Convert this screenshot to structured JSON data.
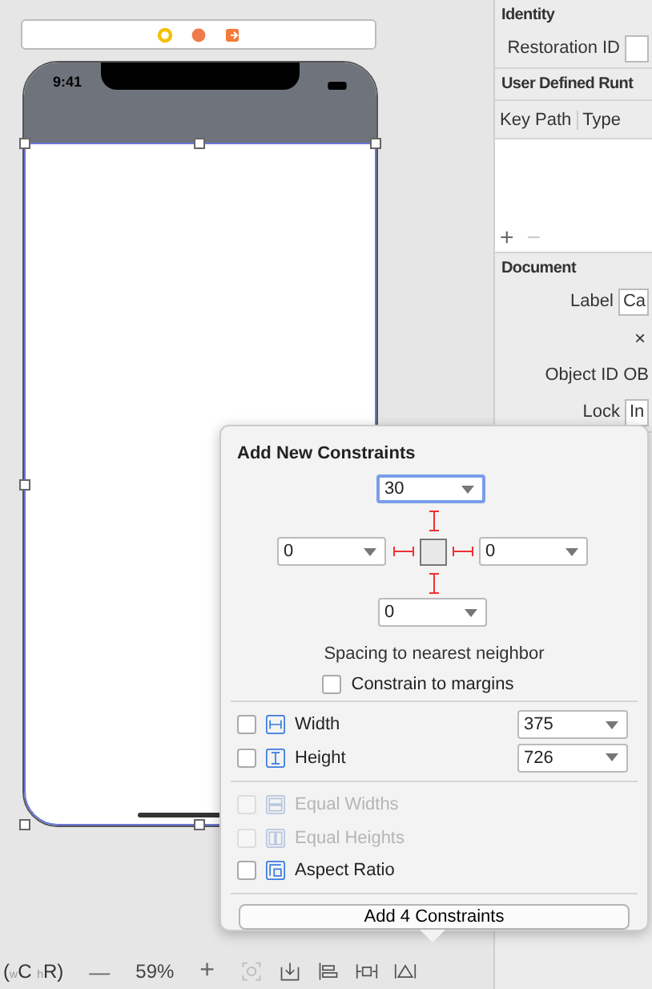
{
  "scene": {
    "status_time": "9:41"
  },
  "inspector": {
    "identity": {
      "title": "Identity",
      "restoration_label": "Restoration ID"
    },
    "runtime": {
      "title": "User Defined Runt",
      "columns": [
        "Key Path",
        "Type"
      ],
      "add": "+",
      "remove": "−"
    },
    "document": {
      "title": "Document",
      "label_label": "Label",
      "label_value": "Ca",
      "clear": "×",
      "object_id_label": "Object ID",
      "object_id_value": "OB",
      "lock_label": "Lock",
      "lock_value": "In"
    }
  },
  "bottom_bar": {
    "size_class": "($_{w}$C $_{h}$R)",
    "zoom_out": "—",
    "zoom": "59%",
    "zoom_in": "+"
  },
  "popover": {
    "title": "Add New Constraints",
    "spacing": {
      "top": {
        "value": "30",
        "on": true,
        "focused": true
      },
      "left": {
        "value": "0",
        "on": true,
        "focused": false
      },
      "right": {
        "value": "0",
        "on": true,
        "focused": false
      },
      "bottom": {
        "value": "0",
        "on": true,
        "focused": false
      }
    },
    "spacing_caption": "Spacing to nearest neighbor",
    "margins": {
      "label": "Constrain to margins",
      "checked": false
    },
    "rows": [
      {
        "kind": "width",
        "label": "Width",
        "checked": false,
        "disabled": false,
        "value": "375"
      },
      {
        "kind": "height",
        "label": "Height",
        "checked": false,
        "disabled": false,
        "value": "726"
      },
      {
        "kind": "equal_widths",
        "label": "Equal Widths",
        "checked": false,
        "disabled": true
      },
      {
        "kind": "equal_heights",
        "label": "Equal Heights",
        "checked": false,
        "disabled": true
      },
      {
        "kind": "aspect",
        "label": "Aspect Ratio",
        "checked": false,
        "disabled": false
      }
    ],
    "button": "Add 4 Constraints"
  }
}
